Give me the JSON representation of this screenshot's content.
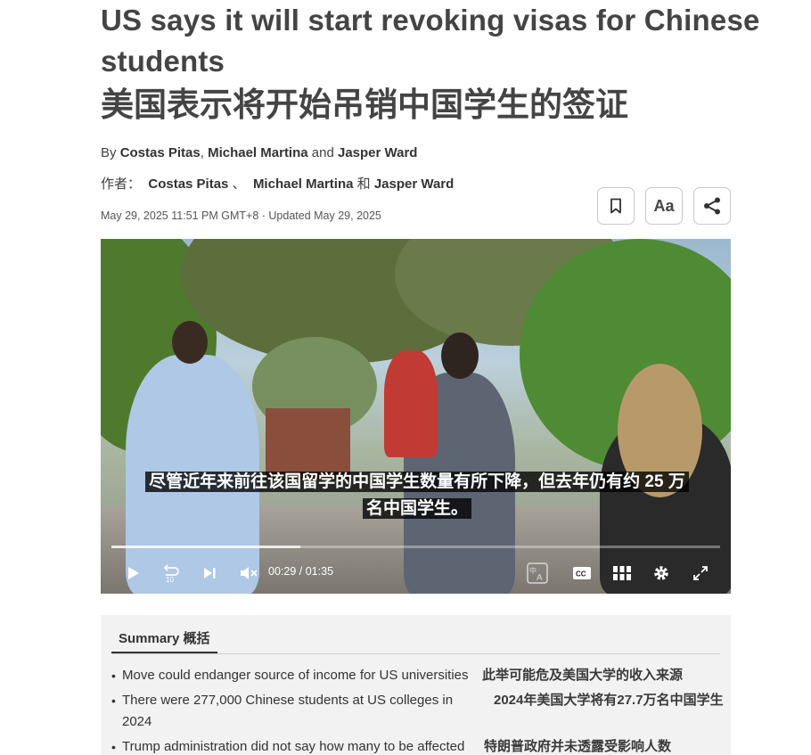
{
  "article": {
    "title_en": "US says it will start revoking visas for Chinese students",
    "title_zh": "美国表示将开始吊销中国学生的签证",
    "byline_en": {
      "prefix": "By ",
      "author1": "Costas Pitas",
      "sep1": ", ",
      "author2": "Michael Martina",
      "sep2": " and ",
      "author3": "Jasper Ward"
    },
    "byline_zh": {
      "prefix": "作者：",
      "author1": "Costas Pitas",
      "sep1": "、",
      "author2": "Michael Martina",
      "sep2": "和",
      "author3": "Jasper Ward"
    },
    "dateline": "May 29, 2025 11:51 PM GMT+8 · Updated May 29, 2025"
  },
  "toolbar": {
    "bookmark_icon": "bookmark-icon",
    "font_label": "Aa",
    "share_icon": "share-icon"
  },
  "video": {
    "subtitle_line1": "尽管近年来前往该国留学的中国学生数量有所下降，但去年仍有约 25 万",
    "subtitle_line2": "名中国学生。",
    "current_time": "00:29",
    "time_sep": "/",
    "duration": "01:35",
    "progress": 0.31,
    "replay_label": "10"
  },
  "summary": {
    "tab_label": "Summary  概括",
    "items": [
      {
        "en": "Move could endanger source of income for US universities",
        "zh": "此举可能危及美国大学的收入来源"
      },
      {
        "en": "There were 277,000 Chinese students at US colleges in 2024",
        "zh": "2024年美国大学将有27.7万名中国学生"
      },
      {
        "en": "Trump administration did not say how many to be affected",
        "zh": "特朗普政府并未透露受影响人数"
      }
    ]
  },
  "colors": {
    "title": "#444444",
    "summary_bg": "#f2f2f2",
    "button_border": "#c8c8c8"
  }
}
